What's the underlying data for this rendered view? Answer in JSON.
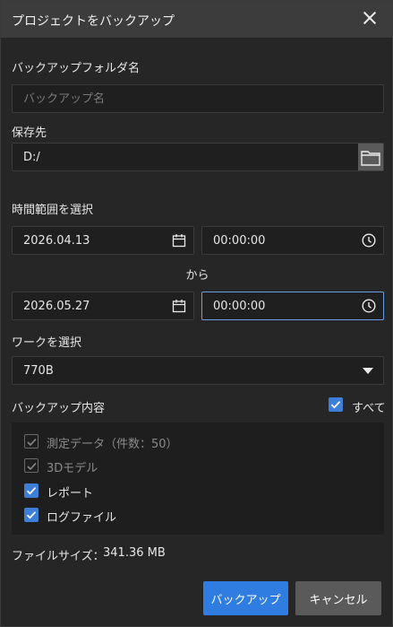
{
  "dialog": {
    "title": "プロジェクトをバックアップ"
  },
  "backup_folder": {
    "label": "バックアップフォルダ名",
    "placeholder": "バックアップ名",
    "value": ""
  },
  "destination": {
    "label": "保存先",
    "value": "D:/"
  },
  "time_range": {
    "label": "時間範囲を選択",
    "start_date": "2026.04.13",
    "start_time": "00:00:00",
    "separator": "から",
    "end_date": "2026.05.27",
    "end_time": "00:00:00"
  },
  "work": {
    "label": "ワークを選択",
    "selected": "770B"
  },
  "content": {
    "label": "バックアップ内容",
    "all_label": "すべて",
    "all_checked": true,
    "options": [
      {
        "label": "測定データ（件数：50）",
        "checked": true,
        "disabled": true
      },
      {
        "label": "3Dモデル",
        "checked": true,
        "disabled": true
      },
      {
        "label": "レポート",
        "checked": true,
        "disabled": false
      },
      {
        "label": "ログファイル",
        "checked": true,
        "disabled": false
      }
    ]
  },
  "file_size": {
    "label": "ファイルサイズ：",
    "value": "341.36 MB"
  },
  "buttons": {
    "backup": "バックアップ",
    "cancel": "キャンセル"
  },
  "colors": {
    "accent": "#2f7de1",
    "background": "#262626",
    "titlebar": "#3c3c3c"
  },
  "icons": {
    "close": "close-icon",
    "folder": "folder-icon",
    "calendar": "calendar-icon",
    "clock": "clock-icon",
    "dropdown": "chevron-down-icon",
    "check": "check-icon"
  }
}
